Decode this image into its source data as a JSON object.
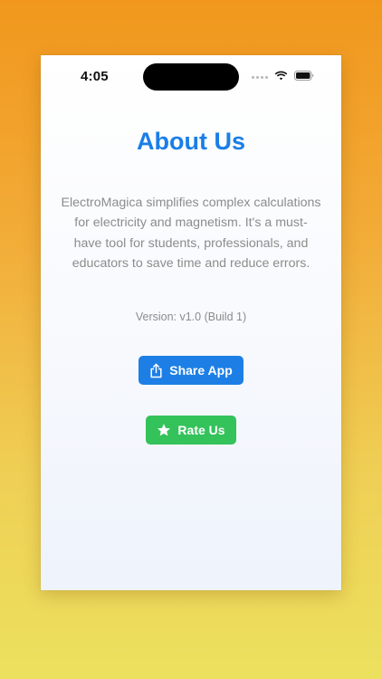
{
  "status_bar": {
    "time": "4:05"
  },
  "about": {
    "title": "About Us",
    "description": "ElectroMagica simplifies complex calculations for electricity and magnetism. It's a must-have tool for students, professionals, and educators to save time and reduce errors.",
    "version": "Version: v1.0 (Build 1)"
  },
  "buttons": {
    "share_label": "Share App",
    "share_icon": "share-icon",
    "rate_label": "Rate Us",
    "rate_icon": "star-icon"
  },
  "colors": {
    "title": "#1a7ee6",
    "share_button": "#1d7fe6",
    "rate_button": "#34c25b",
    "text_muted": "#8c8c8c"
  }
}
